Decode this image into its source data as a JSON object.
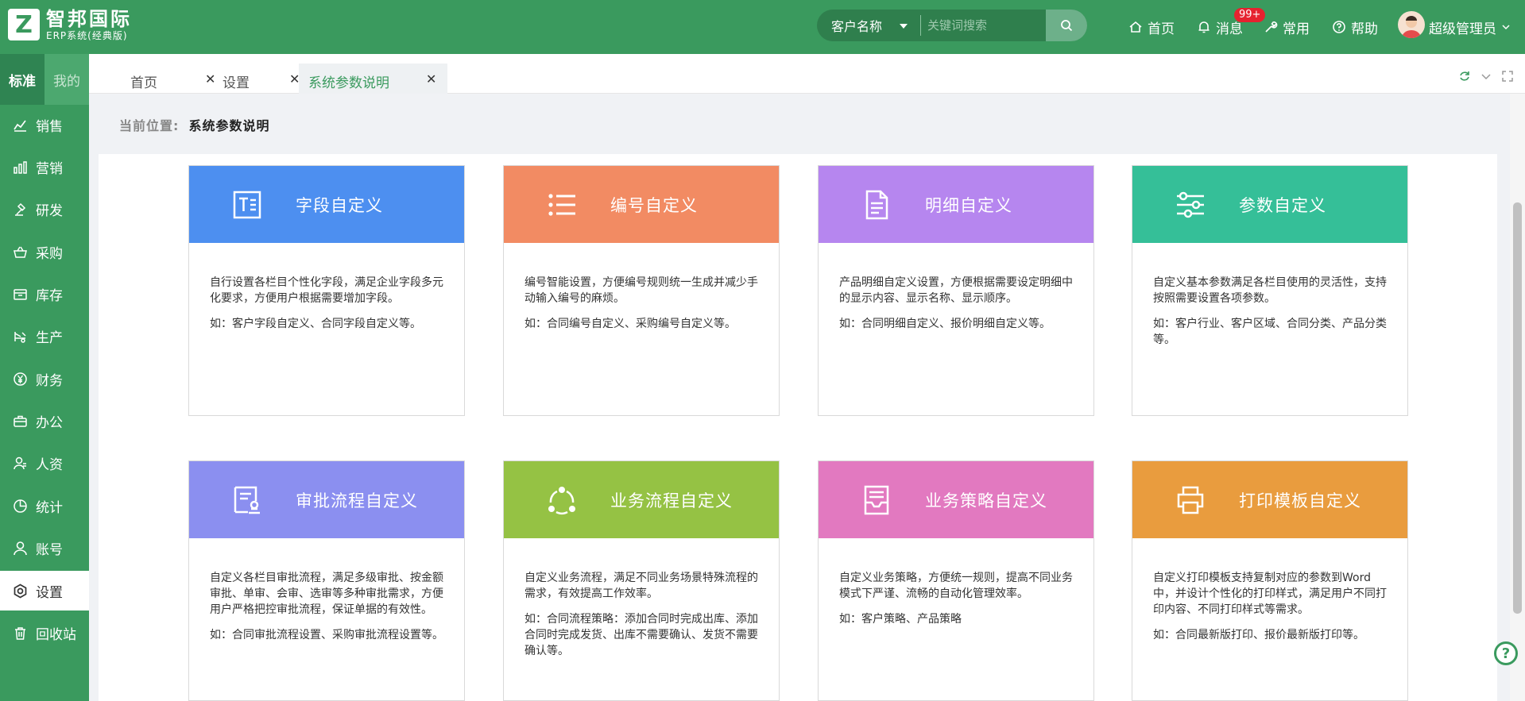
{
  "header": {
    "logo_mark": "Z",
    "brand_title": "智邦国际",
    "brand_subtitle": "ERP系统(经典版)",
    "search": {
      "select_value": "客户名称",
      "placeholder": "关键词搜索"
    },
    "nav": {
      "home": "首页",
      "messages": "消息",
      "messages_badge": "99+",
      "common": "常用",
      "help": "帮助",
      "user": "超级管理员"
    }
  },
  "sidebar": {
    "tab_standard": "标准",
    "tab_mine": "我的",
    "items": [
      {
        "label": "销售",
        "icon": "chart-line-icon"
      },
      {
        "label": "营销",
        "icon": "bar-chart-icon"
      },
      {
        "label": "研发",
        "icon": "research-icon"
      },
      {
        "label": "采购",
        "icon": "basket-icon"
      },
      {
        "label": "库存",
        "icon": "inventory-icon"
      },
      {
        "label": "生产",
        "icon": "production-icon"
      },
      {
        "label": "财务",
        "icon": "yen-icon"
      },
      {
        "label": "办公",
        "icon": "briefcase-icon"
      },
      {
        "label": "人资",
        "icon": "people-icon"
      },
      {
        "label": "统计",
        "icon": "pie-icon"
      },
      {
        "label": "账号",
        "icon": "user-icon"
      },
      {
        "label": "设置",
        "icon": "settings-icon"
      },
      {
        "label": "回收站",
        "icon": "trash-icon"
      }
    ],
    "active_item": "设置"
  },
  "tabs": [
    {
      "label": "首页",
      "close": "✕"
    },
    {
      "label": "设置",
      "close": "✕"
    },
    {
      "label": "系统参数说明",
      "close": "✕"
    }
  ],
  "breadcrumb": {
    "label": "当前位置:",
    "value": "系统参数说明"
  },
  "cards": [
    {
      "title": "字段自定义",
      "color": "#4d8ff0",
      "icon": "text-field-icon",
      "desc": "自行设置各栏目个性化字段，满足企业字段多元化要求，方便用户根据需要增加字段。",
      "example": "如：客户字段自定义、合同字段自定义等。"
    },
    {
      "title": "编号自定义",
      "color": "#f28b63",
      "icon": "list-icon",
      "desc": "编号智能设置，方便编号规则统一生成并减少手动输入编号的麻烦。",
      "example": "如：合同编号自定义、采购编号自定义等。"
    },
    {
      "title": "明细自定义",
      "color": "#b686ef",
      "icon": "document-icon",
      "desc": "产品明细自定义设置，方便根据需要设定明细中的显示内容、显示名称、显示顺序。",
      "example": "如：合同明细自定义、报价明细自定义等。"
    },
    {
      "title": "参数自定义",
      "color": "#35bf98",
      "icon": "sliders-icon",
      "desc": "自定义基本参数满足各栏目使用的灵活性，支持按照需要设置各项参数。",
      "example": "如：客户行业、客户区域、合同分类、产品分类等。"
    },
    {
      "title": "审批流程自定义",
      "color": "#8b8ff0",
      "icon": "approval-icon",
      "desc": "自定义各栏目审批流程，满足多级审批、按金额审批、单审、会审、选审等多种审批需求，方便用户严格把控审批流程，保证单据的有效性。",
      "example": "如：合同审批流程设置、采购审批流程设置等。"
    },
    {
      "title": "业务流程自定义",
      "color": "#95c244",
      "icon": "flow-icon",
      "desc": "自定义业务流程，满足不同业务场景特殊流程的需求，有效提高工作效率。",
      "example": "如：合同流程策略：添加合同时完成出库、添加合同时完成发货、出库不需要确认、发货不需要确认等。"
    },
    {
      "title": "业务策略自定义",
      "color": "#e279c0",
      "icon": "tray-icon",
      "desc": "自定义业务策略，方便统一规则，提高不同业务模式下严谨、流畅的自动化管理效率。",
      "example": "如：客户策略、产品策略"
    },
    {
      "title": "打印模板自定义",
      "color": "#e99c3e",
      "icon": "printer-icon",
      "desc": "自定义打印模板支持复制对应的参数到Word中，并设计个性化的打印样式，满足用户不同打印内容、不同打印样式等需求。",
      "example": "如：合同最新版打印、报价最新版打印等。"
    }
  ],
  "help_fab": "?"
}
